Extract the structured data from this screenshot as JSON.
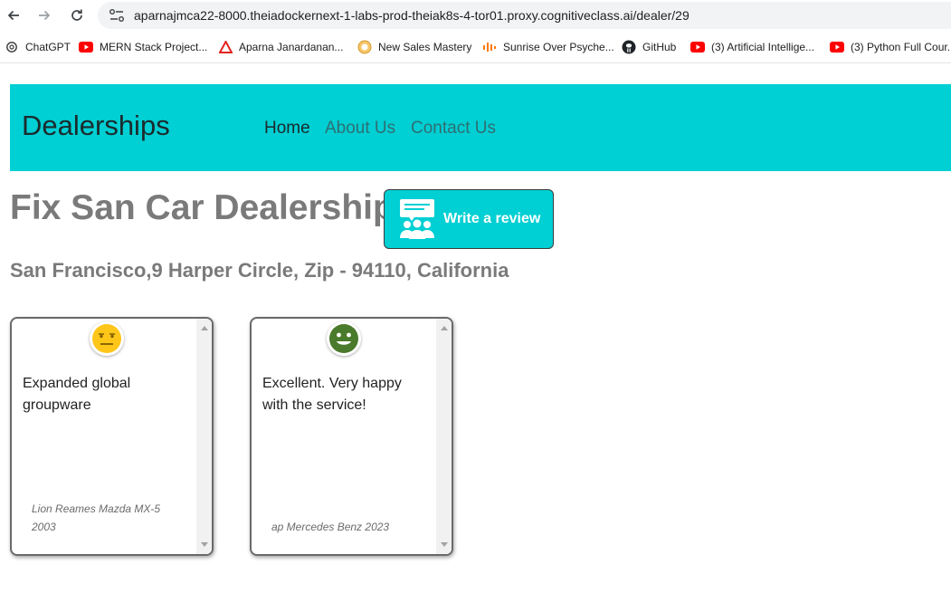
{
  "browser": {
    "url": "aparnajmca22-8000.theiadockernext-1-labs-prod-theiak8s-4-tor01.proxy.cognitiveclass.ai/dealer/29",
    "bookmarks": [
      {
        "label": "ChatGPT",
        "icon": "chatgpt-icon"
      },
      {
        "label": "MERN Stack Project...",
        "icon": "youtube-icon"
      },
      {
        "label": "Aparna Janardanan...",
        "icon": "coursera-icon"
      },
      {
        "label": "New Sales Mastery",
        "icon": "course-icon"
      },
      {
        "label": "Sunrise Over Psyche...",
        "icon": "audio-icon"
      },
      {
        "label": "GitHub",
        "icon": "github-icon"
      },
      {
        "label": "(3) Artificial Intellige...",
        "icon": "youtube-icon"
      },
      {
        "label": "(3) Python Full Cour...",
        "icon": "youtube-icon"
      }
    ]
  },
  "header": {
    "brand": "Dealerships",
    "links": [
      "Home",
      "About Us",
      "Contact Us"
    ]
  },
  "dealer": {
    "name": "Fix San Car Dealership",
    "address": "San Francisco,9 Harper Circle, Zip - 94110, California",
    "review_button_label": "Write a review"
  },
  "reviews": [
    {
      "sentiment": "neutral",
      "icon": "neutral-face-icon",
      "text": "Expanded global groupware",
      "car": "Lion Reames Mazda MX-5 2003"
    },
    {
      "sentiment": "positive",
      "icon": "smiling-face-icon",
      "text": "Excellent. Very happy with the service!",
      "car": "ap Mercedes Benz 2023"
    }
  ],
  "colors": {
    "accent": "#00cfd3",
    "neutral_emoji": "#ffc61a",
    "positive_emoji": "#4a7a2c"
  }
}
